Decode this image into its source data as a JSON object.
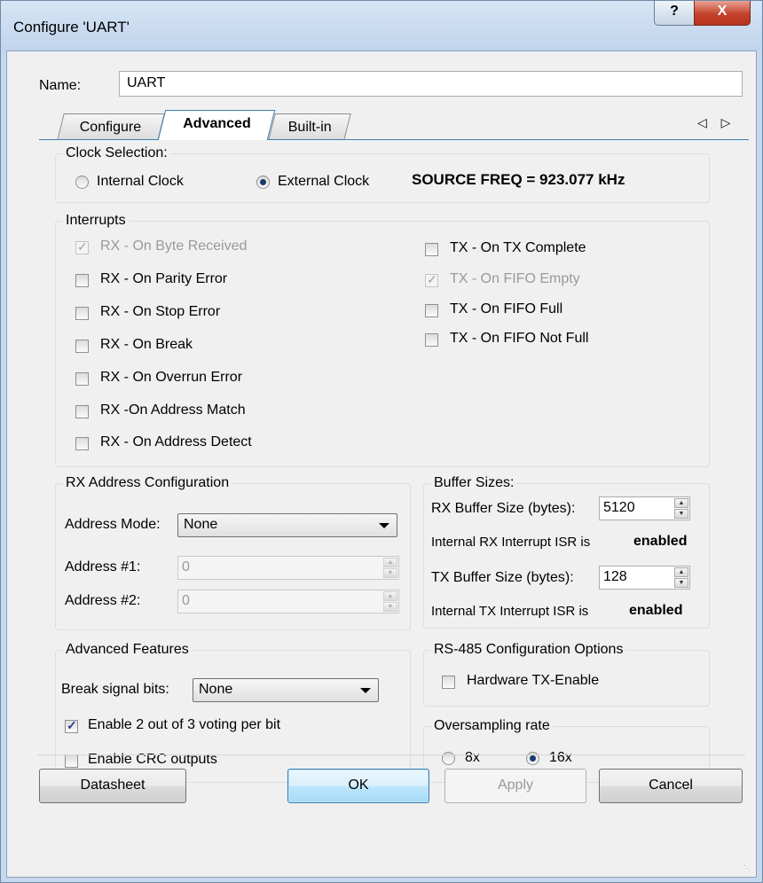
{
  "window": {
    "title": "Configure 'UART'",
    "help_glyph": "?",
    "close_glyph": "X"
  },
  "name": {
    "label": "Name:",
    "value": "UART"
  },
  "tabs": [
    {
      "label": "Configure"
    },
    {
      "label": "Advanced",
      "active": true
    },
    {
      "label": "Built-in"
    }
  ],
  "tab_scroll": "◁ ▷",
  "clock": {
    "title": "Clock Selection:",
    "internal_label": "Internal Clock",
    "external_label": "External Clock",
    "selected": "External Clock",
    "source_freq": "SOURCE FREQ = 923.077 kHz"
  },
  "interrupts": {
    "title": "Interrupts",
    "rx_items": [
      {
        "label": "RX - On Byte Received",
        "checked": true,
        "disabled": true
      },
      {
        "label": "RX - On Parity Error",
        "checked": false,
        "disabled": false
      },
      {
        "label": "RX - On Stop Error",
        "checked": false,
        "disabled": false
      },
      {
        "label": "RX - On Break",
        "checked": false,
        "disabled": false
      },
      {
        "label": "RX - On Overrun Error",
        "checked": false,
        "disabled": false
      },
      {
        "label": "RX -On Address Match",
        "checked": false,
        "disabled": false
      },
      {
        "label": "RX - On Address Detect",
        "checked": false,
        "disabled": false
      }
    ],
    "tx_items": [
      {
        "label": "TX - On TX Complete",
        "checked": false,
        "disabled": false
      },
      {
        "label": "TX - On FIFO Empty",
        "checked": true,
        "disabled": true
      },
      {
        "label": "TX - On FIFO Full",
        "checked": false,
        "disabled": false
      },
      {
        "label": "TX - On FIFO Not Full",
        "checked": false,
        "disabled": false
      }
    ]
  },
  "rx_address": {
    "title": "RX Address Configuration",
    "mode_label": "Address Mode:",
    "mode_value": "None",
    "addr1_label": "Address #1:",
    "addr1_value": "0",
    "addr2_label": "Address #2:",
    "addr2_value": "0"
  },
  "buffer": {
    "title": "Buffer Sizes:",
    "rx_label": "RX Buffer Size (bytes):",
    "rx_value": "5120",
    "rx_isr_text": "Internal RX Interrupt ISR is",
    "rx_isr_state": "enabled",
    "tx_label": "TX Buffer Size (bytes):",
    "tx_value": "128",
    "tx_isr_text": "Internal TX Interrupt ISR is",
    "tx_isr_state": "enabled"
  },
  "advanced": {
    "title": "Advanced Features",
    "break_label": "Break signal bits:",
    "break_value": "None",
    "voting_label": "Enable 2 out of 3 voting per bit",
    "voting_checked": true,
    "crc_label": "Enable CRC outputs",
    "crc_checked": false
  },
  "rs485": {
    "title": "RS-485 Configuration Options",
    "hw_label": "Hardware TX-Enable",
    "hw_checked": false
  },
  "oversampling": {
    "title": "Oversampling rate",
    "opt1": "8x",
    "opt2": "16x",
    "selected": "16x"
  },
  "buttons": {
    "datasheet": "Datasheet",
    "ok": "OK",
    "apply": "Apply",
    "cancel": "Cancel"
  }
}
